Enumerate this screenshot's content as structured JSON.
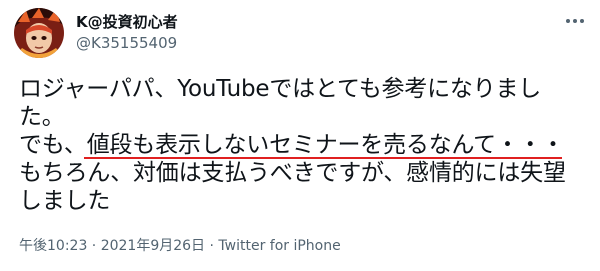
{
  "tweet": {
    "author": {
      "display_name": "K@投資初心者",
      "handle": "@K35155409",
      "avatar_icon": "avatar-illustration"
    },
    "more_icon": "more-horizontal-icon",
    "text_lines": [
      "ロジャーパパ、YouTubeではとても参考になりまし",
      "た。",
      "でも、値段も表示しないセミナーを売るなんて・・・",
      "もちろん、対価は支払うべきですが、感情的には失望",
      "しました"
    ],
    "annotation_color": "#e02020",
    "timestamp": "午後10:23 · 2021年9月26日 · ",
    "source": "Twitter for iPhone"
  }
}
